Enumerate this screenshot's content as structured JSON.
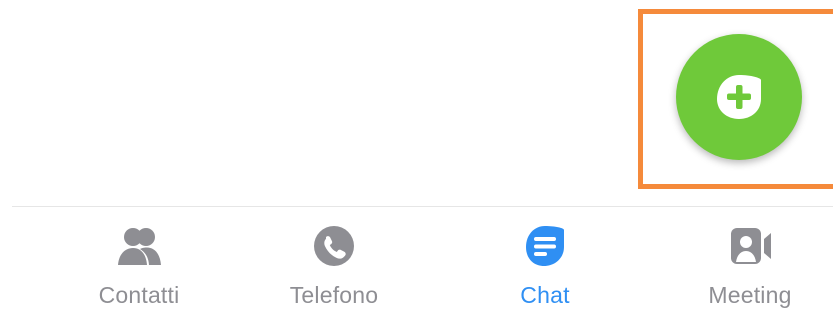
{
  "fab": {
    "icon": "new-chat-plus-icon",
    "color": "#6fc93a"
  },
  "highlight": {
    "color": "#f58a3b"
  },
  "tabbar": {
    "active_color": "#2f8ff3",
    "inactive_color": "#8e8e93",
    "items": [
      {
        "label": "Contatti",
        "icon": "contacts-icon",
        "active": false
      },
      {
        "label": "Telefono",
        "icon": "phone-icon",
        "active": false
      },
      {
        "label": "Chat",
        "icon": "chat-icon",
        "active": true
      },
      {
        "label": "Meeting",
        "icon": "video-meeting-icon",
        "active": false
      }
    ]
  }
}
